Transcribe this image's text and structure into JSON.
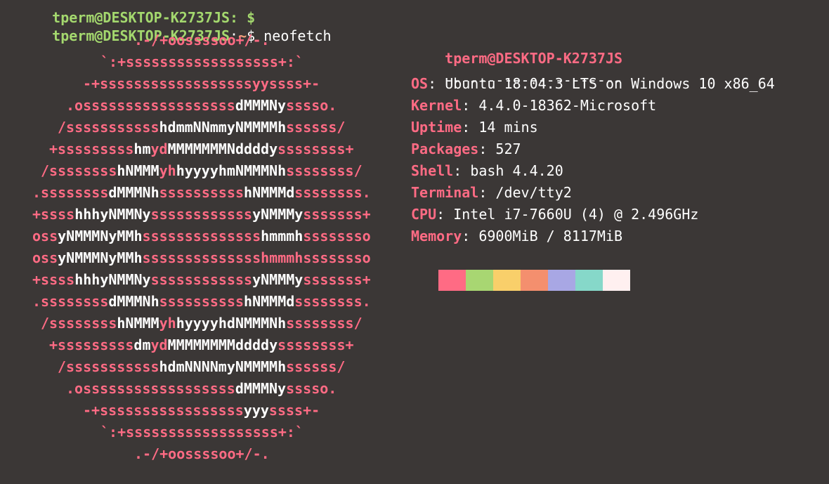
{
  "prompt_partial": {
    "text": "tperm@DESKTOP-K2737JS: $"
  },
  "prompt": {
    "user_host": "tperm@DESKTOP-K2737JS",
    "colon": ":",
    "path": "~",
    "symbol": "$",
    "command": "neofetch"
  },
  "logo": [
    [
      [
        "p",
        ".-/+oossssoo+/-."
      ]
    ],
    [
      [
        "p",
        "`:+ssssssssssssssssss+:`"
      ]
    ],
    [
      [
        "p",
        "-+ssssssssssssssssssyyssss+-"
      ]
    ],
    [
      [
        "p",
        ".ossssssssssssssssss"
      ],
      [
        "w",
        "dMMMNy"
      ],
      [
        "p",
        "sssso."
      ]
    ],
    [
      [
        "p",
        "/sssssssssss"
      ],
      [
        "w",
        "hdmmNNmmyNMMMMh"
      ],
      [
        "p",
        "ssssss/"
      ]
    ],
    [
      [
        "p",
        "+sssssssss"
      ],
      [
        "w",
        "hm"
      ],
      [
        "p",
        "yd"
      ],
      [
        "w",
        "MMMMMMMNddddy"
      ],
      [
        "p",
        "ssssssss+"
      ]
    ],
    [
      [
        "p",
        "/ssssssss"
      ],
      [
        "w",
        "hNMMM"
      ],
      [
        "p",
        "yh"
      ],
      [
        "w",
        "hyyyyhmNMMMNh"
      ],
      [
        "p",
        "ssssssss/"
      ]
    ],
    [
      [
        "p",
        ".ssssssss"
      ],
      [
        "w",
        "dMMMNh"
      ],
      [
        "p",
        "ssssssssss"
      ],
      [
        "w",
        "hNMMMd"
      ],
      [
        "p",
        "ssssssss."
      ]
    ],
    [
      [
        "p",
        "+ssss"
      ],
      [
        "w",
        "hhhyNMMNy"
      ],
      [
        "p",
        "ssssssssssss"
      ],
      [
        "w",
        "yNMMMy"
      ],
      [
        "p",
        "sssssss+"
      ]
    ],
    [
      [
        "p",
        "oss"
      ],
      [
        "w",
        "yNMMMNyMMh"
      ],
      [
        "p",
        "ssssssssssssss"
      ],
      [
        "w",
        "hmmmh"
      ],
      [
        "p",
        "ssssssso"
      ]
    ],
    [
      [
        "p",
        "oss"
      ],
      [
        "w",
        "yNMMMNyMMh"
      ],
      [
        "p",
        "ssssssssssssss"
      ],
      [
        "p",
        "hmmmh"
      ],
      [
        "p",
        "ssssssso"
      ]
    ],
    [
      [
        "p",
        "+ssss"
      ],
      [
        "w",
        "hhhyNMMNy"
      ],
      [
        "p",
        "ssssssssssss"
      ],
      [
        "w",
        "yNMMMy"
      ],
      [
        "p",
        "sssssss+"
      ]
    ],
    [
      [
        "p",
        ".ssssssss"
      ],
      [
        "w",
        "dMMMNh"
      ],
      [
        "p",
        "ssssssssss"
      ],
      [
        "w",
        "hNMMMd"
      ],
      [
        "p",
        "ssssssss."
      ]
    ],
    [
      [
        "p",
        "/ssssssss"
      ],
      [
        "w",
        "hNMMM"
      ],
      [
        "p",
        "yh"
      ],
      [
        "w",
        "hyyyyhdNMMMNh"
      ],
      [
        "p",
        "ssssssss/"
      ]
    ],
    [
      [
        "p",
        "+sssssssss"
      ],
      [
        "w",
        "dm"
      ],
      [
        "p",
        "yd"
      ],
      [
        "w",
        "MMMMMMMMddddy"
      ],
      [
        "p",
        "ssssssss+"
      ]
    ],
    [
      [
        "p",
        "/sssssssssss"
      ],
      [
        "w",
        "hdmNNNNmyNMMMMh"
      ],
      [
        "p",
        "ssssss/"
      ]
    ],
    [
      [
        "p",
        ".ossssssssssssssssss"
      ],
      [
        "w",
        "dMMMNy"
      ],
      [
        "p",
        "sssso."
      ]
    ],
    [
      [
        "p",
        "-+sssssssssssssssss"
      ],
      [
        "w",
        "yyy"
      ],
      [
        "p",
        "ssss+-"
      ]
    ],
    [
      [
        "p",
        "`:+ssssssssssssssssss+:`"
      ]
    ],
    [
      [
        "p",
        ".-/+oossssoo+/-."
      ]
    ]
  ],
  "info": {
    "title": "tperm@DESKTOP-K2737JS",
    "separator": "---------------------",
    "rows": [
      {
        "label": "OS",
        "value": "Ubuntu 18.04.3 LTS on Windows 10 x86_64"
      },
      {
        "label": "Kernel",
        "value": "4.4.0-18362-Microsoft"
      },
      {
        "label": "Uptime",
        "value": "14 mins"
      },
      {
        "label": "Packages",
        "value": "527"
      },
      {
        "label": "Shell",
        "value": "bash 4.4.20"
      },
      {
        "label": "Terminal",
        "value": "/dev/tty2"
      },
      {
        "label": "CPU",
        "value": "Intel i7-7660U (4) @ 2.496GHz"
      },
      {
        "label": "Memory",
        "value": "6900MiB / 8117MiB"
      }
    ]
  },
  "palette": [
    "#ff6b84",
    "#a8d672",
    "#f9cf6a",
    "#f48f6e",
    "#a8a7e4",
    "#86d8c9",
    "#fff0f0"
  ]
}
